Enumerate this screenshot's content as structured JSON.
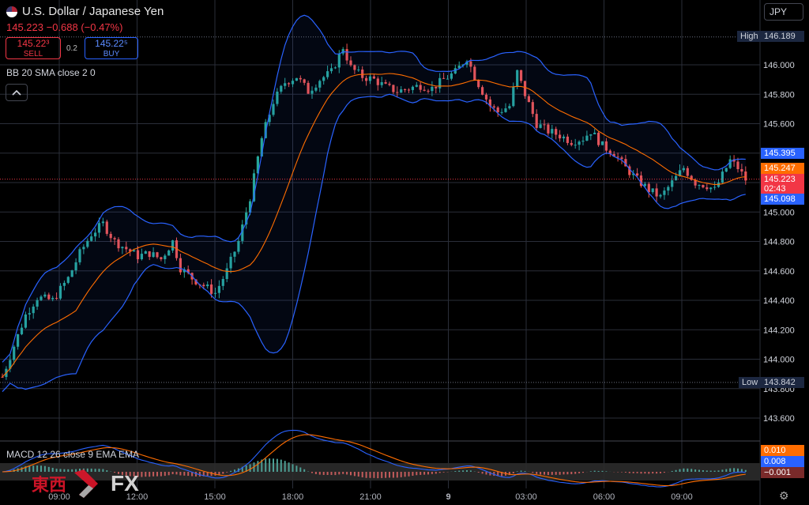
{
  "header": {
    "symbol_title": "U.S. Dollar / Japanese Yen",
    "change_line": "145.223 −0.688 (−0.47%)",
    "sell_price": "145.22³",
    "sell_label": "SELL",
    "spread": "0.2",
    "buy_price": "145.22⁵",
    "buy_label": "BUY",
    "bb_legend": "BB 20 SMA close 2 0",
    "collapse_icon": "chevron-up-icon",
    "currency": "JPY",
    "macd_legend": "MACD 12 26 close 9 EMA EMA"
  },
  "price_axis": {
    "ticks": [
      "146.000",
      "145.800",
      "145.600",
      "145.400",
      "145.200",
      "145.000",
      "144.800",
      "144.600",
      "144.400",
      "144.200",
      "144.000",
      "143.800",
      "143.600"
    ],
    "high_label": "High",
    "high_value": "146.189",
    "low_label": "Low",
    "low_value": "143.842",
    "bb_upper_value": "145.395",
    "sma_value": "145.247",
    "last_value": "145.223",
    "countdown": "02:43",
    "bb_lower_value": "145.098"
  },
  "macd_axis": {
    "macd_value": "0.010",
    "signal_value": "0.008",
    "hist_value": "−0.001"
  },
  "time_axis": {
    "labels": [
      "09:00",
      "12:00",
      "15:00",
      "18:00",
      "21:00",
      "9",
      "03:00",
      "06:00",
      "09:00"
    ]
  },
  "logo": {
    "cn_text": "東西",
    "fx_text": "FX"
  },
  "colors": {
    "up": "#26a69a",
    "down": "#ef5350",
    "bb": "#2962ff",
    "sma": "#ff6d00",
    "grid": "#2a2e39",
    "macd": "#2962ff",
    "signal": "#ff6d00"
  },
  "chart_data": {
    "type": "candlestick",
    "symbol": "USD/JPY",
    "ylim": [
      143.5,
      146.22
    ],
    "x_ticks": [
      "09:00",
      "12:00",
      "15:00",
      "18:00",
      "21:00",
      "9",
      "03:00",
      "06:00",
      "09:00"
    ],
    "price_path": [
      [
        0,
        143.88
      ],
      [
        6,
        144.3
      ],
      [
        9,
        144.42
      ],
      [
        13,
        144.4
      ],
      [
        17,
        144.55
      ],
      [
        20,
        144.72
      ],
      [
        23,
        144.85
      ],
      [
        26,
        144.92
      ],
      [
        29,
        144.8
      ],
      [
        32,
        144.75
      ],
      [
        35,
        144.7
      ],
      [
        38,
        144.72
      ],
      [
        41,
        144.68
      ],
      [
        44,
        144.8
      ],
      [
        46,
        144.62
      ],
      [
        49,
        144.55
      ],
      [
        52,
        144.5
      ],
      [
        55,
        144.45
      ],
      [
        58,
        144.6
      ],
      [
        61,
        144.8
      ],
      [
        64,
        145.1
      ],
      [
        67,
        145.5
      ],
      [
        70,
        145.75
      ],
      [
        73,
        145.88
      ],
      [
        76,
        145.92
      ],
      [
        79,
        145.82
      ],
      [
        82,
        145.9
      ],
      [
        85,
        145.95
      ],
      [
        88,
        146.12
      ],
      [
        90,
        145.98
      ],
      [
        93,
        145.92
      ],
      [
        96,
        145.9
      ],
      [
        99,
        145.85
      ],
      [
        102,
        145.82
      ],
      [
        105,
        145.84
      ],
      [
        108,
        145.86
      ],
      [
        111,
        145.84
      ],
      [
        114,
        145.9
      ],
      [
        117,
        145.95
      ],
      [
        120,
        146.05
      ],
      [
        122,
        145.92
      ],
      [
        124,
        145.82
      ],
      [
        126,
        145.72
      ],
      [
        128,
        145.68
      ],
      [
        131,
        145.72
      ],
      [
        133,
        145.95
      ],
      [
        135,
        145.8
      ],
      [
        138,
        145.6
      ],
      [
        141,
        145.55
      ],
      [
        144,
        145.52
      ],
      [
        147,
        145.48
      ],
      [
        150,
        145.5
      ],
      [
        152,
        145.55
      ],
      [
        155,
        145.45
      ],
      [
        158,
        145.4
      ],
      [
        161,
        145.3
      ],
      [
        164,
        145.22
      ],
      [
        167,
        145.15
      ],
      [
        170,
        145.1
      ],
      [
        173,
        145.2
      ],
      [
        176,
        145.3
      ],
      [
        179,
        145.2
      ],
      [
        182,
        145.18
      ],
      [
        184,
        145.15
      ],
      [
        186,
        145.25
      ],
      [
        188,
        145.35
      ],
      [
        190,
        145.3
      ],
      [
        192,
        145.22
      ]
    ],
    "bollinger": {
      "period": 20,
      "source": "close",
      "stddev": 2,
      "upper": 145.395,
      "basis": 145.247,
      "lower": 145.098
    },
    "high": 146.189,
    "low": 143.842,
    "last": 145.223,
    "macd": {
      "fast": 12,
      "slow": 26,
      "signal": 9,
      "macd": 0.01,
      "signal_value": 0.008,
      "histogram": -0.001
    }
  }
}
